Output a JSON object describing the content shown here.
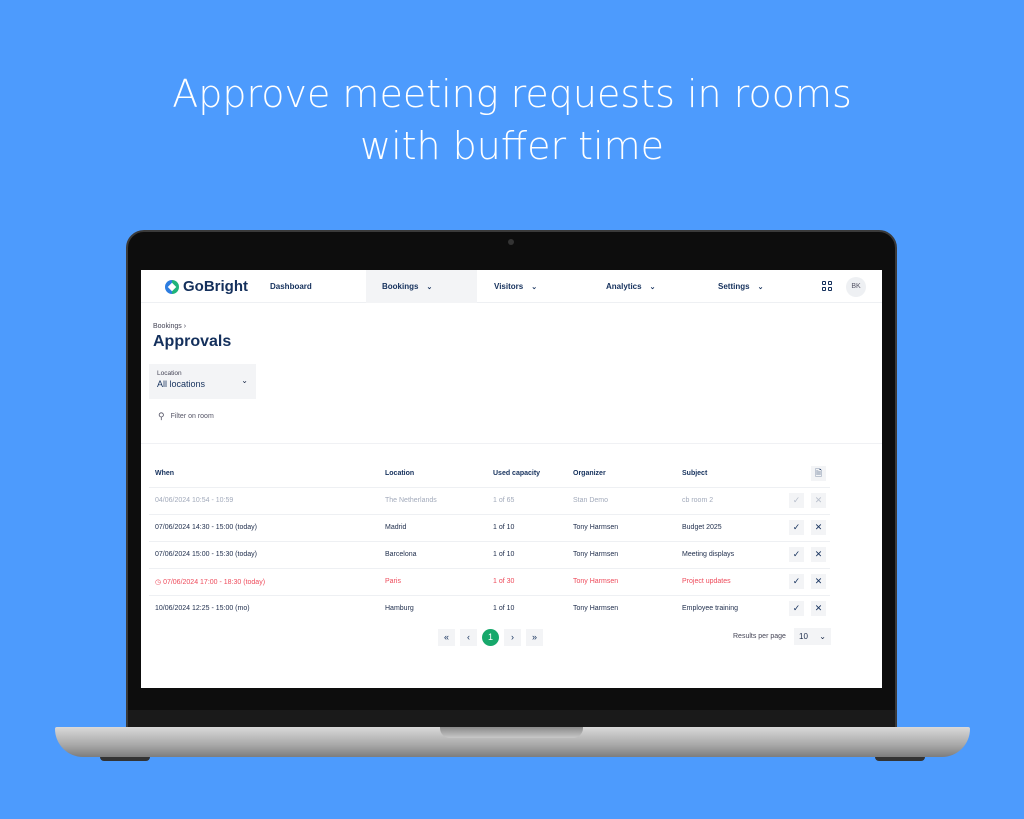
{
  "headline": {
    "line1": "Approve meeting requests in rooms",
    "line2": "with buffer time"
  },
  "nav": {
    "brand": "GoBright",
    "items": [
      {
        "label": "Dashboard"
      },
      {
        "label": "Bookings"
      },
      {
        "label": "Visitors"
      },
      {
        "label": "Analytics"
      },
      {
        "label": "Settings"
      }
    ],
    "avatar": "BK"
  },
  "page": {
    "breadcrumb": "Bookings",
    "title": "Approvals",
    "location_label": "Location",
    "location_value": "All locations",
    "filter_placeholder": "Filter on room"
  },
  "table": {
    "headers": [
      "When",
      "Location",
      "Used capacity",
      "Organizer",
      "Subject"
    ],
    "rows": [
      [
        "04/06/2024 10:54 - 10:59",
        "The Netherlands",
        "1 of 65",
        "Stan Demo",
        "cb room 2"
      ],
      [
        "07/06/2024 14:30 - 15:00 (today)",
        "Madrid",
        "1 of 10",
        "Tony Harmsen",
        "Budget 2025"
      ],
      [
        "07/06/2024 15:00 - 15:30 (today)",
        "Barcelona",
        "1 of 10",
        "Tony Harmsen",
        "Meeting displays"
      ],
      [
        "07/06/2024 17:00 - 18:30 (today)",
        "Paris",
        "1 of 30",
        "Tony Harmsen",
        "Project updates"
      ],
      [
        "10/06/2024 12:25 - 15:00 (mo)",
        "Hamburg",
        "1 of 10",
        "Tony Harmsen",
        "Employee training"
      ]
    ],
    "row_states": [
      "past",
      "normal",
      "normal",
      "conflict",
      "normal"
    ]
  },
  "pagination": {
    "first": "«",
    "prev": "‹",
    "current": "1",
    "next": "›",
    "last": "»",
    "results_label": "Results per page",
    "results_value": "10"
  },
  "colors": {
    "background": "#4d9bfd",
    "accent": "#17a86b",
    "warning": "#ee4b5b",
    "primary_text": "#14305c"
  }
}
